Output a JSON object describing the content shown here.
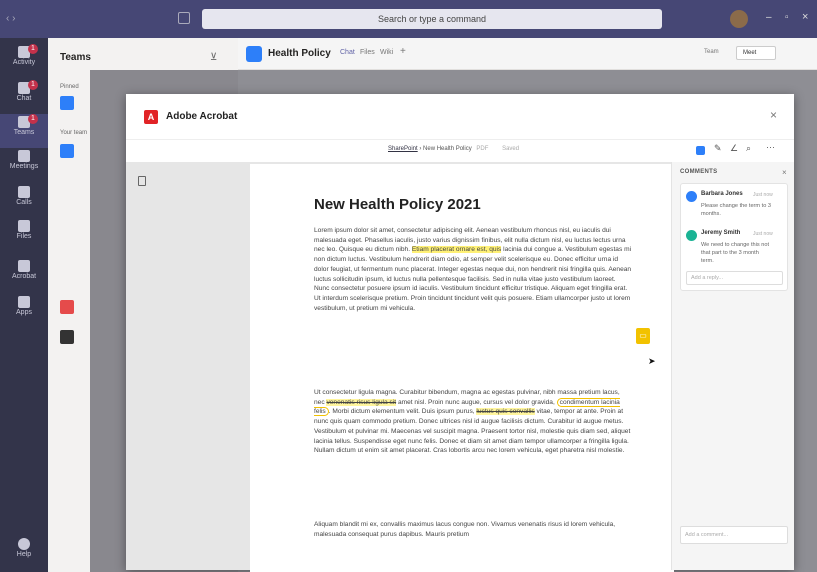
{
  "titlebar": {
    "search_placeholder": "Search or type a command",
    "nav": "‹  ›"
  },
  "rail": {
    "items": [
      {
        "label": "Activity",
        "badge": "1"
      },
      {
        "label": "Chat",
        "badge": "1"
      },
      {
        "label": "Teams",
        "badge": "1"
      },
      {
        "label": "Meetings",
        "badge": ""
      },
      {
        "label": "Calls",
        "badge": ""
      },
      {
        "label": "Files",
        "badge": ""
      },
      {
        "label": "Acrobat",
        "badge": ""
      },
      {
        "label": "Apps",
        "badge": ""
      },
      {
        "label": "Help",
        "badge": ""
      }
    ]
  },
  "teams_panel": {
    "title": "Teams",
    "pinned": "Pinned",
    "your_teams": "Your team"
  },
  "channel": {
    "name": "Health Policy",
    "tabs": [
      "Chat",
      "Files",
      "Wiki"
    ],
    "team_btn": "Team",
    "meet_btn": "Meet"
  },
  "modal": {
    "title": "Adobe Acrobat",
    "breadcrumb_link": "SharePoint",
    "breadcrumb_rest": "› New Health Policy",
    "file_type": "PDF",
    "status": "Saved"
  },
  "document": {
    "title": "New Health Policy 2021",
    "p1_a": "Lorem ipsum dolor sit amet, consectetur adipiscing elit. Aenean vestibulum rhoncus nisl, eu iaculis dui malesuada eget. Phasellus iaculis, justo varius dignissim finibus, elit nulla dictum nisl, eu luctus lectus urna nec leo. Quisque eu dictum nibh. ",
    "p1_hl": "Etiam placerat ornare est, quis",
    "p1_b": " lacinia dui congue a. Vestibulum egestas mi non dictum luctus. Vestibulum hendrerit diam odio, at semper velit scelerisque eu. Donec efficitur urna id dolor feugiat, ut fermentum nunc placerat. Integer egestas neque dui, non hendrerit nisi fringilla quis. Aenean luctus sollicitudin ipsum, id luctus nulla pellentesque facilisis. Sed in nulla vitae justo vestibulum laoreet. Nunc consectetur posuere ipsum id iaculis. Vestibulum tincidunt efficitur tristique. Aliquam eget fringilla erat. Ut interdum scelerisque pretium. Proin tincidunt tincidunt velit quis posuere. Etiam ullamcorper justo ut lorem vestibulum, ut pretium mi vehicula.",
    "p2_a": "Ut consectetur ligula magna. Curabitur bibendum, magna ac egestas pulvinar, nibh massa pretium lacus, nec ",
    "p2_strike": "venenatis risus ligula sit",
    "p2_b": " amet nisl. Proin nunc augue, cursus vel dolor gravida, ",
    "p2_circ": "condimentum lacinia felis",
    "p2_c": ". Morbi dictum elementum velit. Duis ipsum purus, ",
    "p2_strike2": "luctus quis convallis",
    "p2_d": " vitae, tempor at ante. Proin at nunc quis quam commodo pretium. Donec ultrices nisl id augue facilisis dictum. Curabitur id augue metus. Vestibulum et pulvinar mi. Maecenas vel suscipit magna. Praesent tortor nisl, molestie quis diam sed, aliquet lacinia tellus. Suspendisse eget nunc felis. Donec et diam sit amet diam tempor ullamcorper a fringilla ligula. Nullam dictum ut enim sit amet placerat. Cras lobortis arcu nec lorem vehicula, eget pharetra nisl molestie.",
    "p3": "Aliquam blandit mi ex, convallis maximus lacus congue non. Vivamus venenatis risus id lorem vehicula, malesuada consequat purus dapibus. Mauris pretium"
  },
  "comments": {
    "header": "COMMENTS",
    "items": [
      {
        "author": "Barbara Jones",
        "time": "Just now",
        "text": "Please change the term to 3 months.",
        "color": "#2d7ff9"
      },
      {
        "author": "Jeremy Smith",
        "time": "Just now",
        "text": "We need to change this not that part to the 3 month term.",
        "color": "#1ab394"
      }
    ],
    "reply_placeholder": "Add a reply...",
    "add_placeholder": "Add a comment..."
  }
}
